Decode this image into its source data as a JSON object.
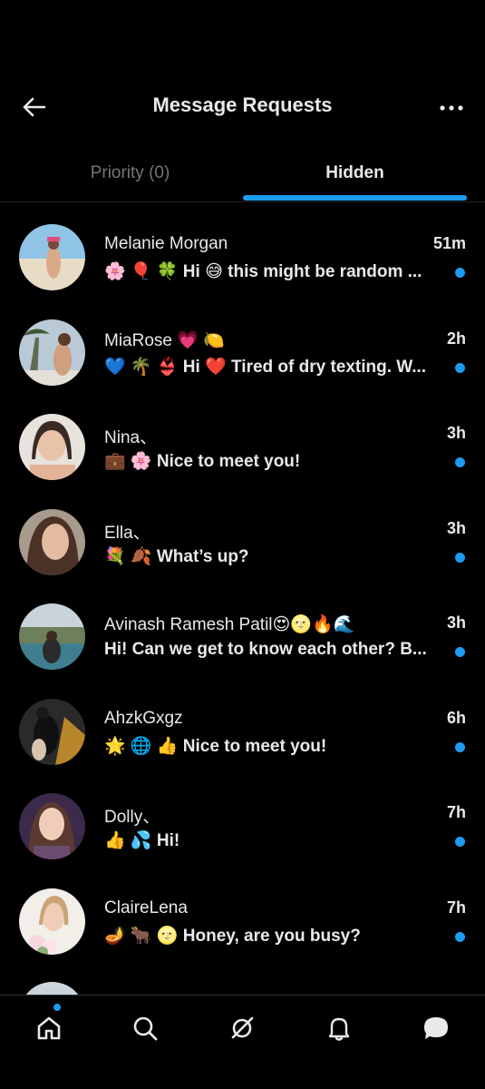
{
  "header": {
    "title": "Message Requests",
    "back_icon": "arrow-left-icon",
    "more_icon": "ellipsis-icon"
  },
  "tabs": [
    {
      "label": "Priority (0)",
      "active": false
    },
    {
      "label": "Hidden",
      "active": true
    }
  ],
  "colors": {
    "accent": "#1d9bf0",
    "background": "#000000",
    "text": "#e7e9ea",
    "muted": "#71767b"
  },
  "messages": [
    {
      "name": "Melanie Morgan",
      "time": "51m",
      "preview": "🌸 🎈 🍀 Hi 😅 this might be random ...",
      "unread": true
    },
    {
      "name": "MiaRose 💗 🍋",
      "time": "2h",
      "preview": "💙 🌴 👙 Hi ❤️ Tired of dry texting. W...",
      "unread": true
    },
    {
      "name": "Nina、",
      "time": "3h",
      "preview": "💼 🌸 Nice to meet you!",
      "unread": true
    },
    {
      "name": "Ella、",
      "time": "3h",
      "preview": "💐 🍂 What’s up?",
      "unread": true
    },
    {
      "name": "Avinash Ramesh Patil😍🌝🔥🌊",
      "time": "3h",
      "preview": "Hi! Can we get to know each other? B...",
      "unread": true
    },
    {
      "name": "AhzkGxgz",
      "time": "6h",
      "preview": "🌟 🌐 👍 Nice to meet you!",
      "unread": true
    },
    {
      "name": "Dolly、",
      "time": "7h",
      "preview": "👍 💦 Hi!",
      "unread": true
    },
    {
      "name": "ClaireLena",
      "time": "7h",
      "preview": "🪔 🐂 🌝 Honey, are you busy?",
      "unread": true
    }
  ],
  "bottom_nav": [
    {
      "icon": "home-icon",
      "has_badge": true
    },
    {
      "icon": "search-icon",
      "has_badge": false
    },
    {
      "icon": "grok-icon",
      "has_badge": false
    },
    {
      "icon": "bell-icon",
      "has_badge": false
    },
    {
      "icon": "messages-icon",
      "has_badge": false
    }
  ]
}
